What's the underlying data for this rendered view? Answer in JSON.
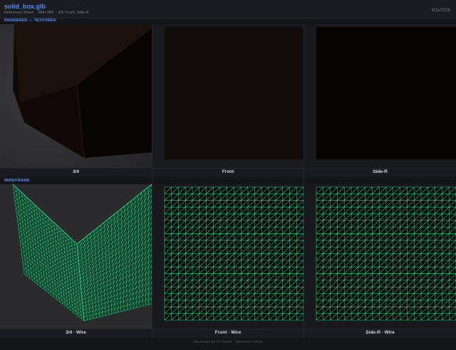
{
  "header": {
    "title": "solid_box.glb",
    "sheet_label": "Reference Sheet",
    "resolution": "384×384",
    "views_label": "3/4, Front, Side-R",
    "date": "8/11/2026"
  },
  "sections": {
    "rendered": "RENDERED — TEXTURED",
    "wireframe": "WIREFRAME"
  },
  "rendered_views": [
    {
      "caption": "3/4"
    },
    {
      "caption": "Front"
    },
    {
      "caption": "Side-R"
    }
  ],
  "wire_views": [
    {
      "caption": "3/4 · Wire"
    },
    {
      "caption": "Front · Wire"
    },
    {
      "caption": "Side-R · Wire"
    }
  ],
  "footer": "Generated by 3D Viewer · Reference Sheet",
  "colors": {
    "accent": "#4f88ff",
    "wire": "#19e08f",
    "box_face": "#0e0806"
  }
}
